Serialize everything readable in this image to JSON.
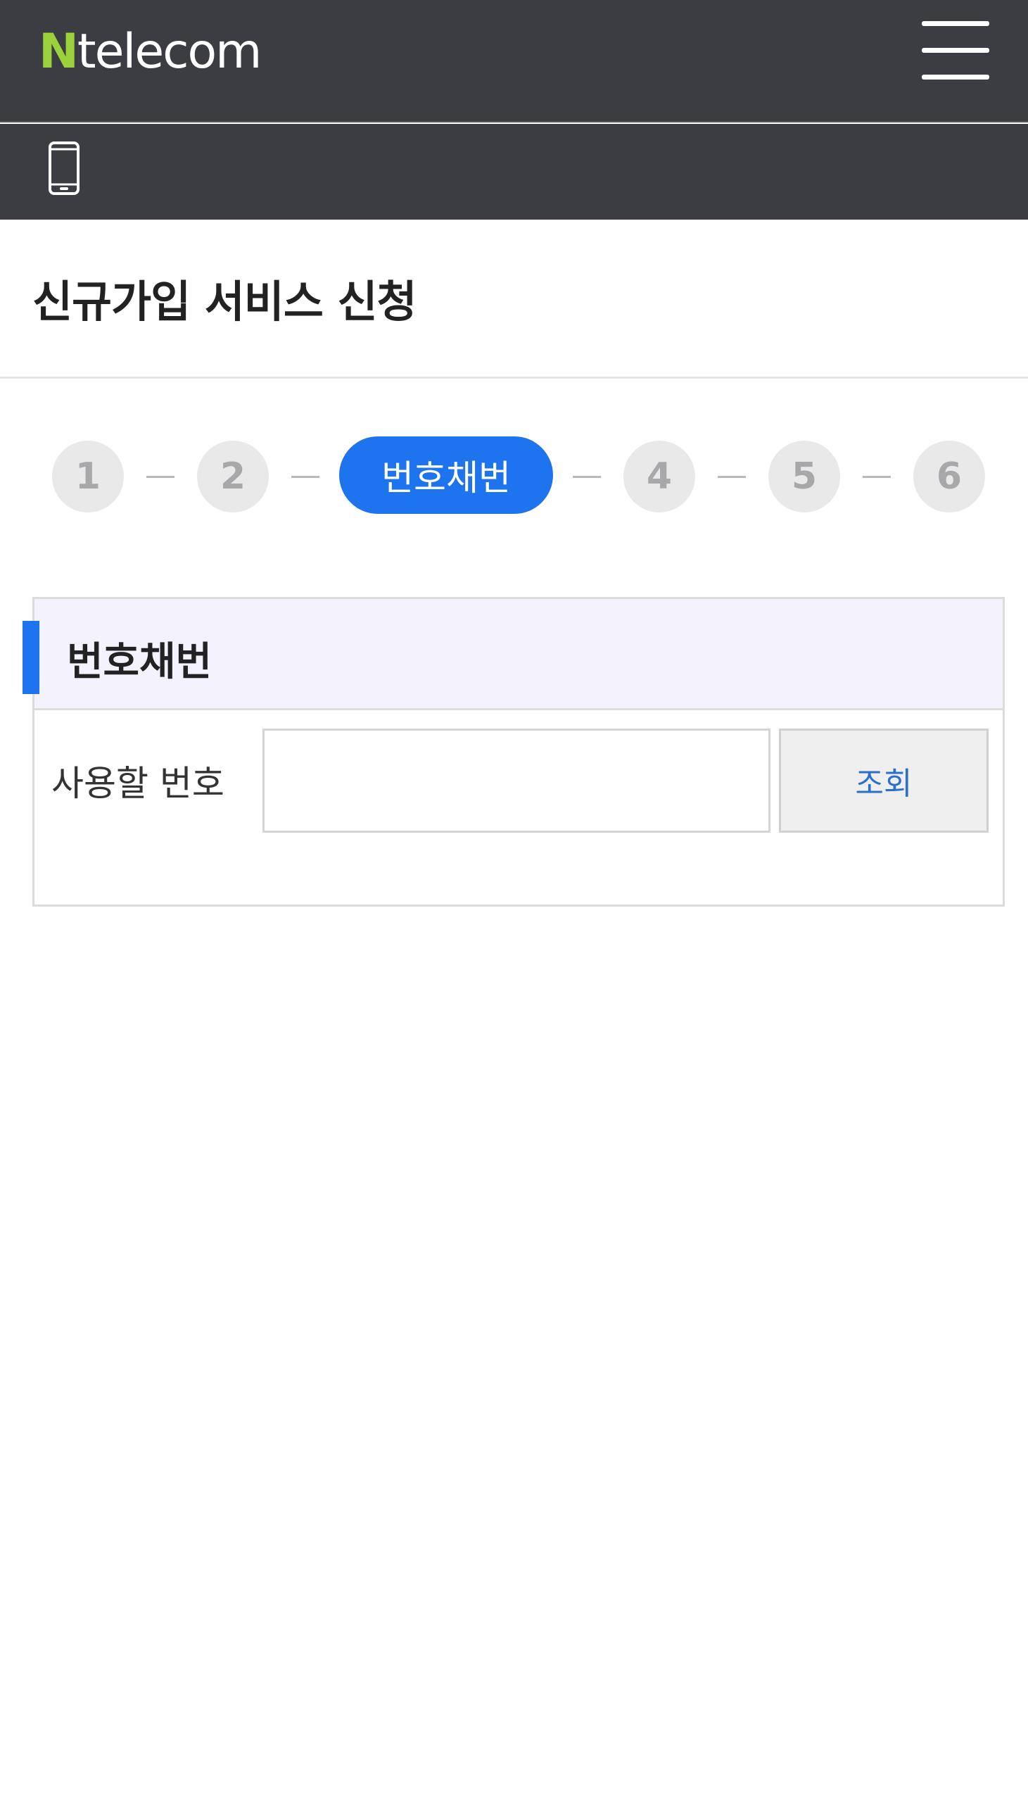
{
  "header": {
    "logo_n": "N",
    "logo_text": "telecom",
    "menu_icon": "hamburger-menu-icon",
    "phone_icon": "mobile-phone-icon"
  },
  "page": {
    "title": "신규가입 서비스 신청"
  },
  "steps": {
    "items": [
      "1",
      "2",
      "번호채번",
      "4",
      "5",
      "6"
    ],
    "active_index": 2
  },
  "panel": {
    "title": "번호채번",
    "field_label": "사용할 번호",
    "input_value": "",
    "input_placeholder": "",
    "search_button": "조회"
  },
  "colors": {
    "header_bg": "#3b3d43",
    "logo_accent": "#9bd13c",
    "primary": "#1e74ee",
    "panel_header_bg": "#f4f2fd"
  }
}
